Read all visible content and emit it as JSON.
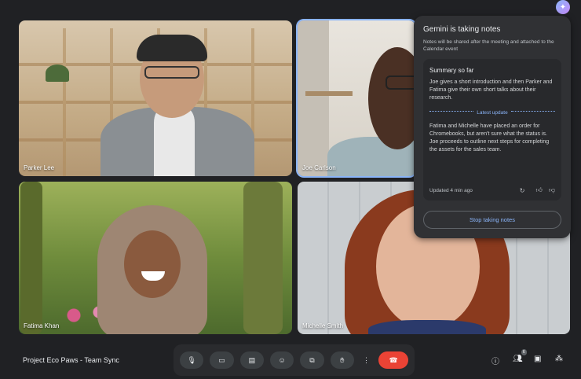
{
  "gemini": {
    "title": "Gemini is taking notes",
    "subtitle": "Notes will be shared after the meeting and attached to the Calendar event",
    "summary_heading": "Summary so far",
    "summary_text": "Joe gives a short introduction and then Parker and Fatima give their own short talks about their research.",
    "latest_label": "Latest update",
    "latest_text": "Fatima and Michelle have placed an order for Chromebooks, but aren't sure what the status is. Joe proceeds to outline next steps for completing the assets for the sales team.",
    "updated": "Updated 4 min ago",
    "stop_label": "Stop taking notes"
  },
  "participants": [
    {
      "name": "Parker Lee"
    },
    {
      "name": "Joe Carlson"
    },
    {
      "name": "Fatima Khan"
    },
    {
      "name": "Michelle Smith"
    }
  ],
  "meeting": {
    "title": "Project Eco Paws - Team Sync",
    "people_count": "6"
  },
  "icons": {
    "gemini": "sparkle-icon",
    "refresh": "refresh-icon",
    "thumbs_up": "thumbs-up-icon",
    "thumbs_down": "thumbs-down-icon",
    "mic": "mic-icon",
    "camera": "camera-icon",
    "captions": "captions-icon",
    "emoji": "emoji-icon",
    "present": "present-icon",
    "raise_hand": "hand-icon",
    "more": "more-icon",
    "end_call": "end-call-icon",
    "info": "info-icon",
    "people": "people-icon",
    "chat": "chat-icon",
    "activities": "activities-icon"
  },
  "colors": {
    "accent": "#8ab4f8",
    "end_call": "#ea4335",
    "background": "#202124"
  }
}
